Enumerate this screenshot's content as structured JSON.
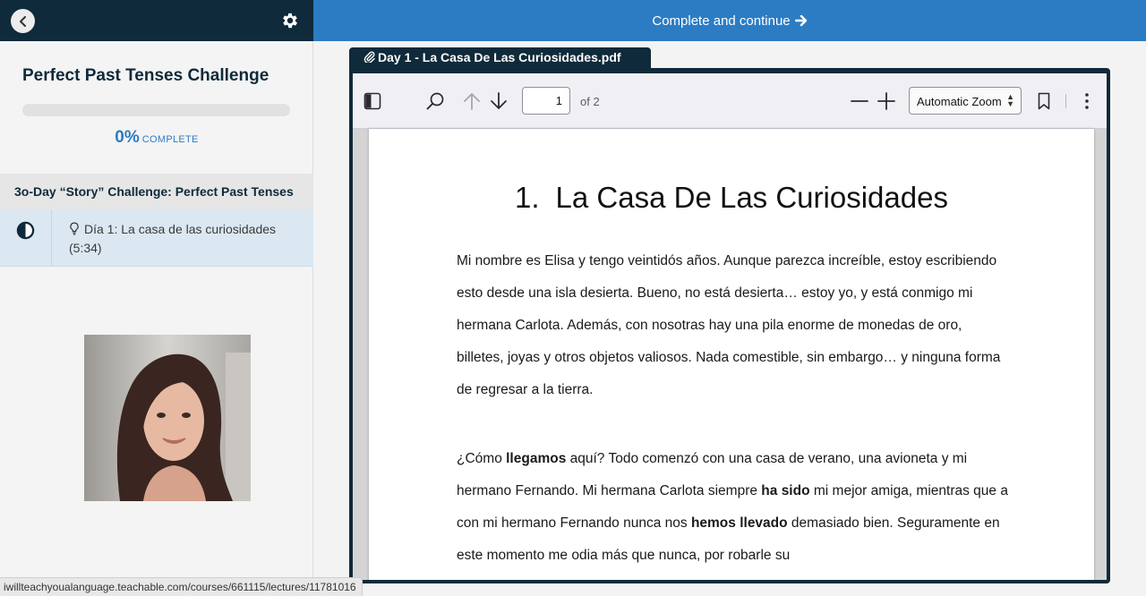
{
  "sidebar": {
    "course_title": "Perfect Past Tenses Challenge",
    "progress": {
      "percent_label": "0%",
      "word": "COMPLETE",
      "value": 0
    },
    "section_title": "3o-Day “Story” Challenge: Perfect Past Tenses",
    "lecture": {
      "title": "Día 1: La casa de las curiosidades (5:34)"
    }
  },
  "topbar": {
    "label": "Complete and continue"
  },
  "attachment": {
    "filename": "Day 1 - La Casa De Las Curiosidades.pdf"
  },
  "pdf_viewer": {
    "page_number": "1",
    "page_count_label": "of 2",
    "zoom": "Automatic Zoom"
  },
  "document": {
    "heading_number": "1.",
    "heading_title": "La Casa De Las Curiosidades",
    "p1": "Mi nombre es Elisa y tengo veintidós años. Aunque parezca increíble, estoy escribiendo esto desde una isla desierta. Bueno, no está desierta… estoy yo, y está conmigo mi hermana Carlota. Además, con nosotras hay una pila enorme de monedas de oro, billetes, joyas y otros objetos valiosos. Nada comestible, sin embargo… y ninguna forma de regresar a la tierra.",
    "p2_a": "¿Cómo ",
    "p2_b1": "llegamos",
    "p2_c": " aquí? Todo comenzó con una casa de verano, una avioneta y mi hermano Fernando. Mi hermana Carlota siempre ",
    "p2_b2": "ha sido",
    "p2_d": " mi mejor amiga, mientras que a con mi hermano Fernando nunca nos ",
    "p2_b3": "hemos llevado",
    "p2_e": " demasiado bien. Seguramente en este momento me odia más que nunca, por robarle su"
  },
  "status_bar": {
    "url": "iwillteachyoualanguage.teachable.com/courses/661115/lectures/11781016"
  },
  "colors": {
    "navy": "#0f2a3a",
    "accent": "#2c7cc4"
  },
  "icons": [
    "back-arrow-icon",
    "gear-icon",
    "half-circle-status-icon",
    "lightbulb-icon",
    "paperclip-icon",
    "sidebar-toggle-icon",
    "search-icon",
    "arrow-up-icon",
    "arrow-down-icon",
    "zoom-out-icon",
    "zoom-in-icon",
    "bookmark-icon",
    "more-vertical-icon",
    "arrow-right-icon"
  ]
}
